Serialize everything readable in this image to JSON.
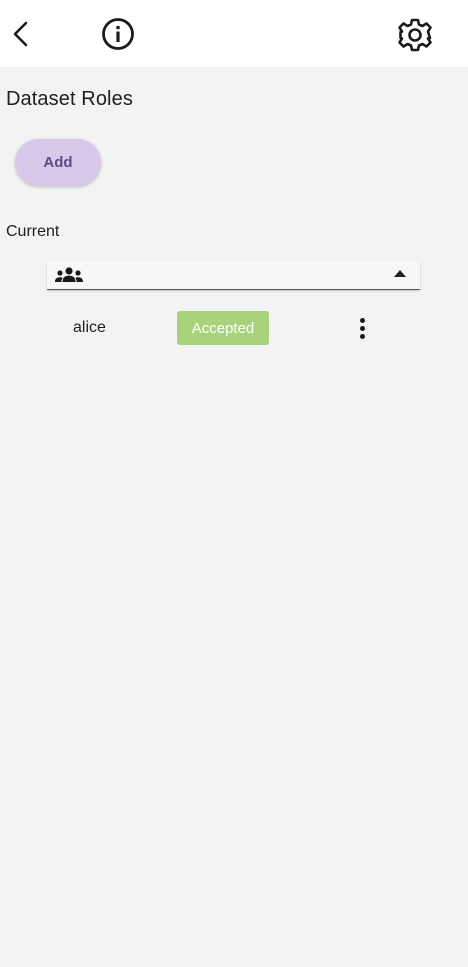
{
  "header": {
    "back_icon": "chevron-left-icon",
    "info_icon": "info-icon",
    "settings_icon": "gear-icon"
  },
  "page": {
    "title": "Dataset Roles",
    "add_label": "Add",
    "section_label": "Current"
  },
  "group": {
    "icon": "group-icon",
    "expanded": true,
    "members": [
      {
        "name": "alice",
        "status": "Accepted"
      }
    ]
  },
  "colors": {
    "accent": "#d6c9ea",
    "accent_text": "#5b4c86",
    "status_accepted": "#a8d27c",
    "background": "#f3f3f3"
  }
}
